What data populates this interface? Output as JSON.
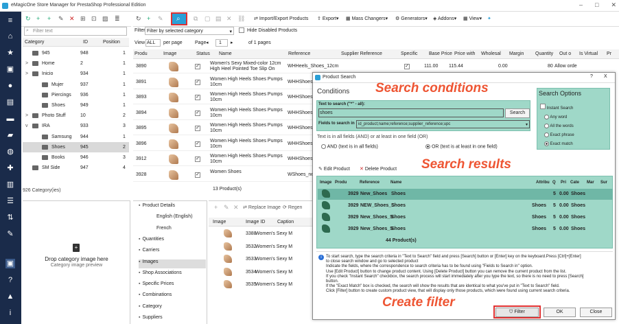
{
  "app_title": "eMagicOne Store Manager for PrestaShop Professional Edition",
  "category_panel": {
    "filter_placeholder": "Filter text",
    "headers": {
      "category": "Category",
      "id": "ID",
      "position": "Position"
    },
    "rows": [
      {
        "name": "945",
        "id": "948",
        "pos": "1",
        "expand": ""
      },
      {
        "name": "Home",
        "id": "2",
        "pos": "1",
        "expand": ">"
      },
      {
        "name": "Inicio",
        "id": "934",
        "pos": "1",
        "expand": ">"
      },
      {
        "name": "Mujer",
        "id": "937",
        "pos": "1",
        "expand": ""
      },
      {
        "name": "Piercings",
        "id": "936",
        "pos": "1",
        "expand": ""
      },
      {
        "name": "Shoes",
        "id": "949",
        "pos": "1",
        "expand": ""
      },
      {
        "name": "Photo Stuff",
        "id": "10",
        "pos": "2",
        "expand": ">"
      },
      {
        "name": "IRA",
        "id": "933",
        "pos": "3",
        "expand": "v"
      },
      {
        "name": "Samsung",
        "id": "944",
        "pos": "1",
        "expand": ""
      },
      {
        "name": "Shoes",
        "id": "945",
        "pos": "2",
        "expand": ""
      },
      {
        "name": "Books",
        "id": "946",
        "pos": "3",
        "expand": ""
      },
      {
        "name": "SM Side",
        "id": "947",
        "pos": "4",
        "expand": ""
      }
    ],
    "footer": "926 Category(ies)",
    "dropzone_title": "Drop category image here",
    "dropzone_sub": "Category image preview"
  },
  "toolbar": {
    "import_export": "Import/Export Products",
    "export": "Export",
    "mass_changers": "Mass Changers",
    "generators": "Generators",
    "addons": "Addons",
    "view": "View"
  },
  "filter_bar": {
    "label": "Filter",
    "value": "Filter by selected category",
    "hide_disabled": "Hide Disabled Products",
    "view_label": "View",
    "view_value": "ALL",
    "per_page": "per page",
    "page_label": "Page",
    "page_value": "1",
    "of_pages": "of 1 pages"
  },
  "grid": {
    "headers": [
      "Produ",
      "Image",
      "Status",
      "Name",
      "Reference",
      "Supplier Reference",
      "Specific",
      "Base Price",
      "Price with",
      "Wholesal",
      "Margin",
      "Quantity",
      "Out o",
      "Is Virtual",
      "Pr"
    ],
    "rows": [
      {
        "id": "3890",
        "name": "Women's Sexy Mixed-color 12cm High Heel Pointed Toe Slip On",
        "ref": "WHHeels_Shoes_12cm",
        "base": "111.00",
        "pwith": "115.44",
        "whole": "0.00",
        "qty": "80",
        "out": "Allow orde"
      },
      {
        "id": "3891",
        "name": "Women High Heels Shoes Pumps 10cm",
        "ref": "WHHShoes_10"
      },
      {
        "id": "3893",
        "name": "Women High Heels Shoes Pumps 10cm",
        "ref": "WHHShoes_10"
      },
      {
        "id": "3894",
        "name": "Women High Heels Shoes Pumps 10cm",
        "ref": "WHHShoes_10"
      },
      {
        "id": "3895",
        "name": "Women High Heels Shoes Pumps 10cm",
        "ref": "WHHShoes_10"
      },
      {
        "id": "3896",
        "name": "Women High Heels Shoes Pumps 10cm",
        "ref": "WHHShoes_10"
      },
      {
        "id": "3912",
        "name": "Women High Heels Shoes Pumps 10cm",
        "ref": "WHHShoes_10"
      },
      {
        "id": "3928",
        "name": "Women Shoes",
        "ref": "WShoes_new"
      }
    ],
    "footer": "13 Product(s)"
  },
  "details": {
    "tabs": [
      "Product Details",
      "English (English)",
      "French",
      "Quantities",
      "Carriers",
      "Images",
      "Shop Associations",
      "Specific Prices",
      "Combinations",
      "Category",
      "Suppliers"
    ],
    "replace_image": "Replace Image",
    "regen": "Regen",
    "img_headers": [
      "Image",
      "Image ID",
      "Caption"
    ],
    "img_rows": [
      {
        "id": "3388",
        "cap": "Women's Sexy M"
      },
      {
        "id": "3532",
        "cap": "Women's Sexy M"
      },
      {
        "id": "3533",
        "cap": "Women's Sexy M"
      },
      {
        "id": "3534",
        "cap": "Women's Sexy M"
      },
      {
        "id": "3535",
        "cap": "Women's Sexy M"
      }
    ]
  },
  "dialog": {
    "title": "Product Search",
    "help": "?",
    "close": "X",
    "conditions": "Conditions",
    "text_label": "Text to search (\"*\" - all):",
    "text_value": "shoes",
    "search_btn": "Search",
    "fields_label": "Fields to search in",
    "fields_value": "id_product;name;reference;supplier_reference;upc",
    "desc": "Text is in all fields (AND) or at least in one field (OR)",
    "and_label": "AND (text is in all fields)",
    "or_label": "OR (text is at least in one field)",
    "options_title": "Search Options",
    "instant": "Instant Search",
    "opt_any": "Any word",
    "opt_all": "All the words",
    "opt_exact_phrase": "Exact phrase",
    "opt_exact_match": "Exact match",
    "edit_product": "Edit Product",
    "delete_product": "Delete Product",
    "res_headers": [
      "Image",
      "Produ",
      "Reference",
      "Name",
      "Attribu",
      "Q",
      "Pri",
      "Cate",
      "Mar",
      "Sur"
    ],
    "res_rows": [
      {
        "id": "3929",
        "ref": "New_Shoes",
        "name": "Shoes",
        "attr": "",
        "q": "5",
        "pri": "0.00",
        "cat": "Shoes"
      },
      {
        "id": "3929",
        "ref": "NEW_Shoes_S",
        "name": "Shoes",
        "attr": "Shoes",
        "q": "5",
        "pri": "0.00",
        "cat": "Shoes"
      },
      {
        "id": "3929",
        "ref": "New_Shoes_S",
        "name": "Shoes",
        "attr": "Shoes",
        "q": "5",
        "pri": "0.00",
        "cat": "Shoes"
      },
      {
        "id": "3929",
        "ref": "New_Shoes_S",
        "name": "Shoes",
        "attr": "Shoes",
        "q": "5",
        "pri": "0.00",
        "cat": "Shoes"
      }
    ],
    "res_footer": "44 Product(s)",
    "info": [
      "To start search, type the search criteria in \"Text to Search\" field and press [Search] button or [Enter] key on the keyboard.Press [Ctrl]+[Enter]",
      "to close search window and go to selected product",
      "Indicate the fields, where the correspondence to search criteria has to be found using \"Fields to Search in\" option.",
      "Use [Edit Product] button to change product content. Using [Delete Product] button you can remove the current product from the list.",
      "If you check \"Instant Search\" checkbox, the search process will start immediately after you type the text, so there is no need to press [Search]",
      "button.",
      "If the \"Exact Match\" box is checked, the search will show the results that are identical to what you've put in \"Text to Search\" field.",
      "Click [Filter] button to create custom product view, that will display only those products, which were found using current search criteria."
    ],
    "filter_btn": "Filter",
    "ok_btn": "OK",
    "close_btn": "Close"
  },
  "overlays": {
    "search_conditions": "Search conditions",
    "search_results": "Search results",
    "create_filter": "Create filter"
  },
  "colors": {
    "accent": "#2a9fd6",
    "panel": "#9fd8c8",
    "overlay": "#ee5533",
    "highlight": "#e03030"
  }
}
